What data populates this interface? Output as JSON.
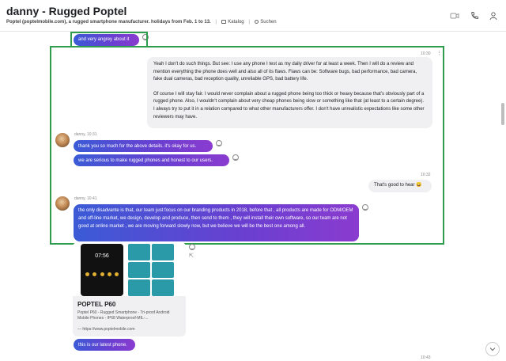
{
  "header": {
    "title": "danny - Rugged Poptel",
    "subtitle": "Poptel (poptelmobile.com), a rugged smartphone manufacturer. holidays from Feb. 1 to 13.",
    "catalog_label": "Katalog",
    "search_label": "Suchen"
  },
  "messages": {
    "m0": {
      "text": "and very angrey about it"
    },
    "m1": {
      "time": "10:30",
      "p1": "Yeah I don't do such things. But see: I use any phone I test as my daily driver for at least a week. Then I will do a review and mention everything the phone does well and also all of its flaws. Flaws can be: Software bugs, bad performance, bad camera, fake dual cameras, bad reception quality, unreliable GPS, bad battery life.",
      "p2": "Of course I will stay fair. I would never complain about a rugged phone being too thick or heavy because that's obviously part of a rugged phone. Also, I wouldn't complain about very cheap phones being slow or something like that (at least to a certain degree). I always try to put it in a relation compared to what other manufacturers offer. I don't have unrealistic expectations like some other reviewers may have."
    },
    "m2": {
      "sender": "danny, 10:31",
      "b1": "thank you so much for the above details. it's okay for us.",
      "b2": "we are serious to make rugged phones and honest to our users."
    },
    "m3": {
      "time": "10:32",
      "text": "That's good to hear 😄"
    },
    "m4": {
      "sender": "danny, 10:41",
      "text": "the only disadvante is that, our team just focus on our branding products in 2018, before that , all products are made for ODM/OEM and off-line market, we design, develop and produce,  then send to them , they will install their own software,  so our team are not good at online market ,  we are moving forward slowly now, but we believe we will be the best one among all."
    },
    "link_card": {
      "phone_time": "07:56",
      "title": "POPTEL P60",
      "description": "Poptel P60 - Rugged Smartphone - Tri-proof Android Mobile Phones - IP68 Waterproof-MIL-...",
      "url": "— https://www.poptelmobile.com"
    },
    "m5": {
      "text": "this is our latest phone."
    },
    "m6": {
      "time": "10:43"
    }
  },
  "colors": {
    "incoming_gradient_start": "#3b5bd6",
    "incoming_gradient_end": "#8a3ccf",
    "outgoing_bubble": "#f0f0f2",
    "highlight_box": "#2e9e4e"
  },
  "icons": {
    "header": [
      "video-camera-icon",
      "phone-icon",
      "user-profile-icon"
    ],
    "reaction": "smiley-icon",
    "share": "share-icon",
    "scroll": "chevron-down-icon"
  }
}
